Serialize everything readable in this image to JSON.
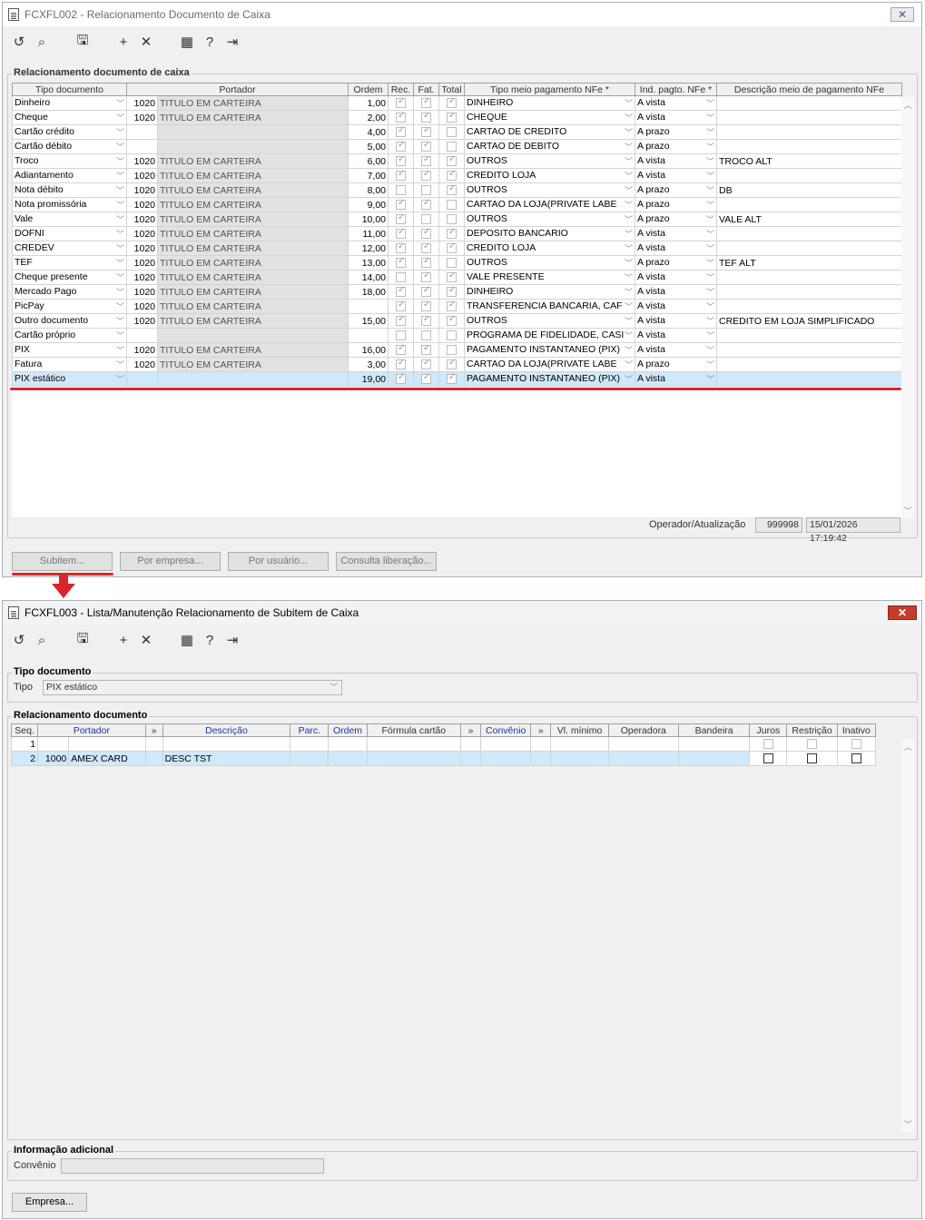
{
  "window1": {
    "title": "FCXFL002 - Relacionamento Documento de Caixa",
    "close": "✕",
    "group_title": "Relacionamento documento de caixa",
    "columns": [
      "Tipo documento",
      "Portador",
      "",
      "Ordem",
      "Rec.",
      "Fat.",
      "Total",
      "Tipo meio pagamento NFe *",
      "Ind. pagto. NFe *",
      "Descrição meio de pagamento NFe"
    ],
    "rows": [
      {
        "tipo": "Dinheiro",
        "cod": "1020",
        "portador": "TITULO EM CARTEIRA",
        "ordem": "1,00",
        "rec": true,
        "fat": true,
        "total": true,
        "meio": "DINHEIRO",
        "ind": "A vista",
        "desc": ""
      },
      {
        "tipo": "Cheque",
        "cod": "1020",
        "portador": "TITULO EM CARTEIRA",
        "ordem": "2,00",
        "rec": true,
        "fat": true,
        "total": true,
        "meio": "CHEQUE",
        "ind": "A vista",
        "desc": ""
      },
      {
        "tipo": "Cartão crédito",
        "cod": "",
        "portador": "",
        "ordem": "4,00",
        "rec": true,
        "fat": true,
        "total": false,
        "meio": "CARTAO DE CREDITO",
        "ind": "A prazo",
        "desc": ""
      },
      {
        "tipo": "Cartão débito",
        "cod": "",
        "portador": "",
        "ordem": "5,00",
        "rec": true,
        "fat": true,
        "total": false,
        "meio": "CARTAO DE DEBITO",
        "ind": "A prazo",
        "desc": ""
      },
      {
        "tipo": "Troco",
        "cod": "1020",
        "portador": "TITULO EM CARTEIRA",
        "ordem": "6,00",
        "rec": true,
        "fat": true,
        "total": true,
        "meio": "OUTROS",
        "ind": "A vista",
        "desc": "TROCO ALT"
      },
      {
        "tipo": "Adiantamento",
        "cod": "1020",
        "portador": "TITULO EM CARTEIRA",
        "ordem": "7,00",
        "rec": true,
        "fat": true,
        "total": true,
        "meio": "CREDITO LOJA",
        "ind": "A vista",
        "desc": ""
      },
      {
        "tipo": "Nota débito",
        "cod": "1020",
        "portador": "TITULO EM CARTEIRA",
        "ordem": "8,00",
        "rec": false,
        "fat": false,
        "total": true,
        "meio": "OUTROS",
        "ind": "A prazo",
        "desc": "DB"
      },
      {
        "tipo": "Nota promissória",
        "cod": "1020",
        "portador": "TITULO EM CARTEIRA",
        "ordem": "9,00",
        "rec": true,
        "fat": true,
        "total": false,
        "meio": "CARTAO DA LOJA(PRIVATE LABE",
        "ind": "A prazo",
        "desc": ""
      },
      {
        "tipo": "Vale",
        "cod": "1020",
        "portador": "TITULO EM CARTEIRA",
        "ordem": "10,00",
        "rec": true,
        "fat": false,
        "total": false,
        "meio": "OUTROS",
        "ind": "A prazo",
        "desc": "VALE ALT"
      },
      {
        "tipo": "DOFNI",
        "cod": "1020",
        "portador": "TITULO EM CARTEIRA",
        "ordem": "11,00",
        "rec": true,
        "fat": true,
        "total": true,
        "meio": "DEPOSITO BANCARIO",
        "ind": "A vista",
        "desc": ""
      },
      {
        "tipo": "CREDEV",
        "cod": "1020",
        "portador": "TITULO EM CARTEIRA",
        "ordem": "12,00",
        "rec": true,
        "fat": true,
        "total": true,
        "meio": "CREDITO LOJA",
        "ind": "A vista",
        "desc": ""
      },
      {
        "tipo": "TEF",
        "cod": "1020",
        "portador": "TITULO EM CARTEIRA",
        "ordem": "13,00",
        "rec": true,
        "fat": true,
        "total": false,
        "meio": "OUTROS",
        "ind": "A prazo",
        "desc": "TEF ALT"
      },
      {
        "tipo": "Cheque presente",
        "cod": "1020",
        "portador": "TITULO EM CARTEIRA",
        "ordem": "14,00",
        "rec": false,
        "fat": true,
        "total": true,
        "meio": "VALE PRESENTE",
        "ind": "A vista",
        "desc": ""
      },
      {
        "tipo": "Mercado Pago",
        "cod": "1020",
        "portador": "TITULO EM CARTEIRA",
        "ordem": "18,00",
        "rec": true,
        "fat": true,
        "total": true,
        "meio": "DINHEIRO",
        "ind": "A vista",
        "desc": ""
      },
      {
        "tipo": "PicPay",
        "cod": "1020",
        "portador": "TITULO EM CARTEIRA",
        "ordem": "",
        "rec": true,
        "fat": true,
        "total": true,
        "meio": "TRANSFERENCIA BANCARIA, CAF",
        "ind": "A vista",
        "desc": ""
      },
      {
        "tipo": "Outro documento",
        "cod": "1020",
        "portador": "TITULO EM CARTEIRA",
        "ordem": "15,00",
        "rec": true,
        "fat": true,
        "total": true,
        "meio": "OUTROS",
        "ind": "A vista",
        "desc": "CREDITO EM LOJA SIMPLIFICADO"
      },
      {
        "tipo": "Cartão próprio",
        "cod": "",
        "portador": "",
        "ordem": "",
        "rec": false,
        "fat": false,
        "total": false,
        "meio": "PROGRAMA DE FIDELIDADE, CASI",
        "ind": "A vista",
        "desc": ""
      },
      {
        "tipo": "PIX",
        "cod": "1020",
        "portador": "TITULO EM CARTEIRA",
        "ordem": "16,00",
        "rec": true,
        "fat": true,
        "total": false,
        "meio": "PAGAMENTO INSTANTANEO (PIX)",
        "ind": "A vista",
        "desc": ""
      },
      {
        "tipo": "Fatura",
        "cod": "1020",
        "portador": "TITULO EM CARTEIRA",
        "ordem": "3,00",
        "rec": true,
        "fat": true,
        "total": true,
        "meio": "CARTAO DA LOJA(PRIVATE LABE",
        "ind": "A prazo",
        "desc": ""
      },
      {
        "tipo": "PIX estático",
        "cod": "",
        "portador": "",
        "ordem": "19,00",
        "rec": true,
        "fat": true,
        "total": true,
        "meio": "PAGAMENTO INSTANTANEO (PIX)",
        "ind": "A vista",
        "desc": ""
      }
    ],
    "selected_row": 19,
    "footer_label": "Operador/Atualização",
    "operator": "999998",
    "updated": "15/01/2026 17:19:42",
    "buttons": [
      "Subitem...",
      "Por empresa...",
      "Por usuário...",
      "Consulta liberação..."
    ]
  },
  "window2": {
    "title": "FCXFL003 - Lista/Manutenção Relacionamento de Subitem de Caixa",
    "close": "✕",
    "tipo_group": "Tipo documento",
    "tipo_label": "Tipo",
    "tipo_value": "PIX estático",
    "rel_group": "Relacionamento documento",
    "columns": [
      "Seq.",
      "Portador",
      "»",
      "Descrição",
      "Parc.",
      "Ordem",
      "Fórmula cartão",
      "»",
      "Convênio",
      "»",
      "Vl. mínimo",
      "Operadora",
      "Bandeira",
      "Juros",
      "Restrição",
      "Inativo"
    ],
    "rows": [
      {
        "seq": "1",
        "cod": "",
        "portador": "",
        "desc": ""
      },
      {
        "seq": "2",
        "cod": "1000",
        "portador": "AMEX CARD",
        "desc": "DESC TST"
      }
    ],
    "info_group": "Informação adicional",
    "convenio_label": "Convênio",
    "convenio_value": "",
    "empresa_button": "Empresa..."
  },
  "colors": {
    "selection": "#cfe8fa",
    "annotation": "#d9262b",
    "close_red": "#c43c2c"
  },
  "icons": [
    "undo-icon",
    "search-icon",
    "save-icon",
    "add-icon",
    "delete-icon",
    "calendar-icon",
    "help-icon",
    "exit-icon"
  ]
}
